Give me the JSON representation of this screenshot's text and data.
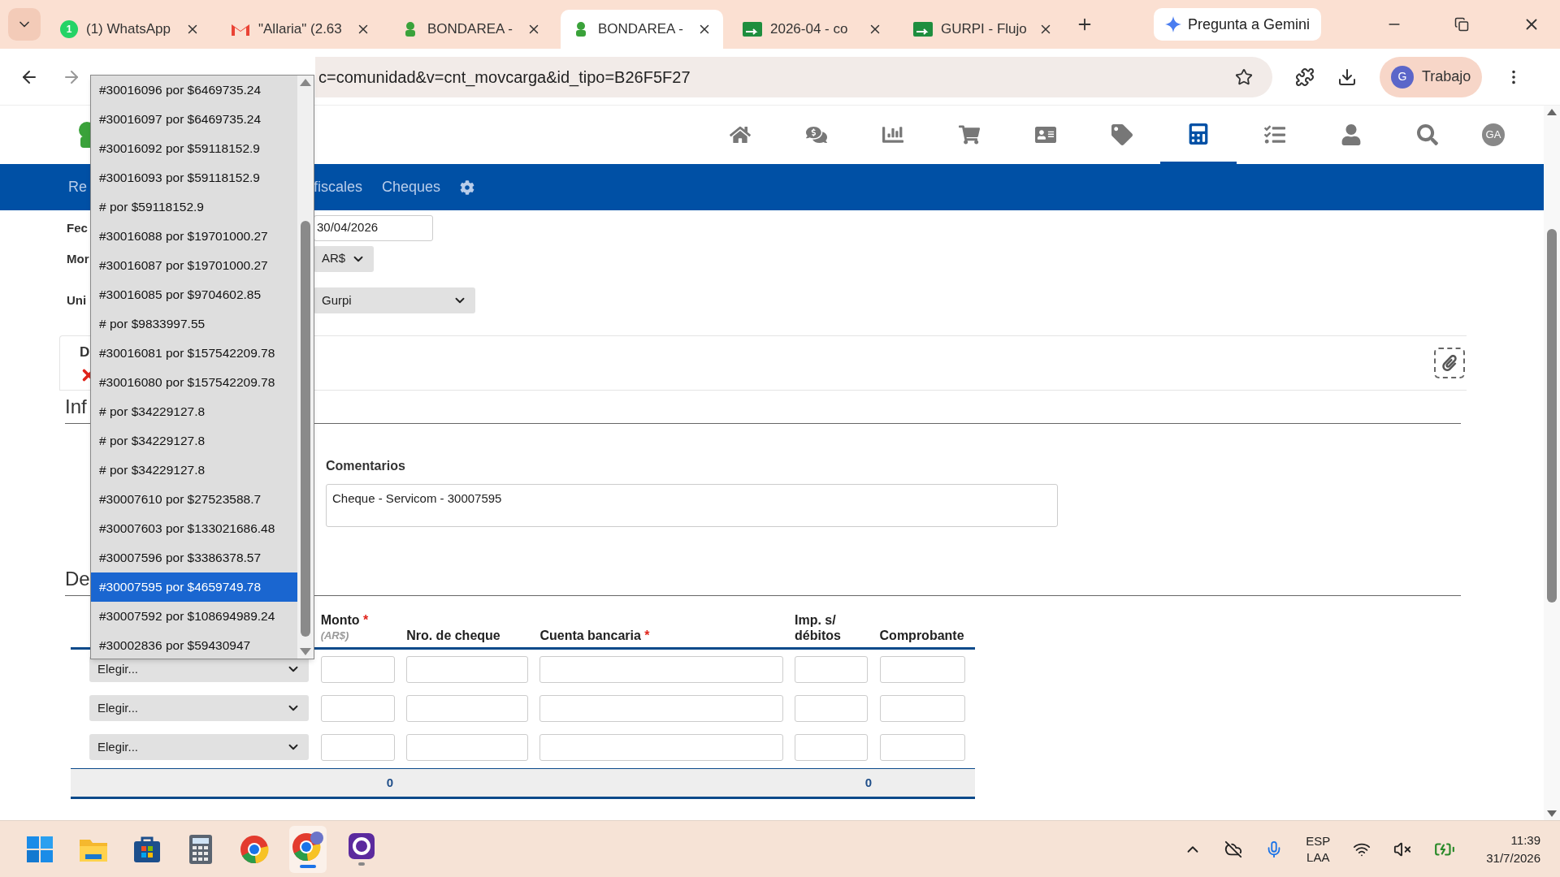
{
  "browser": {
    "tabs": [
      {
        "title": "(1) WhatsApp",
        "kind": "whatsapp",
        "badge": "1",
        "selected": false
      },
      {
        "title": "\"Allaria\" (2.63",
        "kind": "gmail",
        "selected": false
      },
      {
        "title": "BONDAREA -",
        "kind": "bondarea",
        "selected": false
      },
      {
        "title": "BONDAREA -",
        "kind": "bondarea",
        "selected": true
      },
      {
        "title": "2026-04 - co",
        "kind": "sheets",
        "selected": false
      },
      {
        "title": "GURPI - Flujo",
        "kind": "sheets",
        "selected": false
      }
    ],
    "gemini": "Pregunta a Gemini",
    "url": "c=comunidad&v=cnt_movcarga&id_tipo=B26F5F27",
    "profile": {
      "initial": "G",
      "label": "Trabajo"
    }
  },
  "header": {
    "icons": [
      {
        "kind": "home",
        "selected": false
      },
      {
        "kind": "chat",
        "selected": false
      },
      {
        "kind": "chart",
        "selected": false
      },
      {
        "kind": "cart",
        "selected": false
      },
      {
        "kind": "card",
        "selected": false
      },
      {
        "kind": "tag",
        "selected": false
      },
      {
        "kind": "calculator",
        "selected": true
      },
      {
        "kind": "tasks",
        "selected": false
      },
      {
        "kind": "user",
        "selected": false
      },
      {
        "kind": "search",
        "selected": false
      }
    ],
    "avatar": "GA"
  },
  "subnav": [
    "Re",
    "fiscales",
    "Cheques"
  ],
  "form": {
    "fields": [
      {
        "label": "Fec",
        "kind": "date",
        "value": "30/04/2026"
      },
      {
        "label": "Mor",
        "kind": "select",
        "value": "AR$"
      },
      {
        "label": "Uni",
        "kind": "select",
        "value": "Gurpi"
      }
    ]
  },
  "card": {
    "title": "D"
  },
  "sections": [
    "Inf",
    "De"
  ],
  "comments": {
    "label": "Comentarios",
    "value": "Cheque - Servicom - 30007595"
  },
  "table": {
    "columns": [
      {
        "title": "Monto",
        "required_mark": "*",
        "unit": "(AR$)"
      },
      {
        "title": "Nro. de cheque"
      },
      {
        "title": "Cuenta bancaria",
        "required_mark": "*"
      },
      {
        "title": "Imp. s/ débitos"
      },
      {
        "title": "Comprobante"
      }
    ],
    "rows": [
      {
        "selection": "Elegir..."
      },
      {
        "selection": "Elegir..."
      },
      {
        "selection": "Elegir..."
      }
    ],
    "totals": {
      "monto": "0",
      "imp": "0"
    }
  },
  "dropdown": {
    "options": [
      {
        "label": "#30016096 por $6469735.24",
        "selected": false
      },
      {
        "label": "#30016097 por $6469735.24",
        "selected": false
      },
      {
        "label": "#30016092 por $59118152.9",
        "selected": false
      },
      {
        "label": "#30016093 por $59118152.9",
        "selected": false
      },
      {
        "label": "# por $59118152.9",
        "selected": false
      },
      {
        "label": "#30016088 por $19701000.27",
        "selected": false
      },
      {
        "label": "#30016087 por $19701000.27",
        "selected": false
      },
      {
        "label": "#30016085 por $9704602.85",
        "selected": false
      },
      {
        "label": "# por $9833997.55",
        "selected": false
      },
      {
        "label": "#30016081 por $157542209.78",
        "selected": false
      },
      {
        "label": "#30016080 por $157542209.78",
        "selected": false
      },
      {
        "label": "# por $34229127.8",
        "selected": false
      },
      {
        "label": "# por $34229127.8",
        "selected": false
      },
      {
        "label": "# por $34229127.8",
        "selected": false
      },
      {
        "label": "#30007610 por $27523588.7",
        "selected": false
      },
      {
        "label": "#30007603 por $133021686.48",
        "selected": false
      },
      {
        "label": "#30007596 por $3386378.57",
        "selected": false
      },
      {
        "label": "#30007595 por $4659749.78",
        "selected": true
      },
      {
        "label": "#30007592 por $108694989.24",
        "selected": false
      },
      {
        "label": "#30002836 por $59430947",
        "selected": false
      }
    ]
  },
  "taskbar": {
    "apps": [
      {
        "kind": "windows",
        "active": false,
        "running": false
      },
      {
        "kind": "folder",
        "active": false,
        "running": false
      },
      {
        "kind": "store",
        "active": false,
        "running": false
      },
      {
        "kind": "calculator",
        "active": false,
        "running": false
      },
      {
        "kind": "chrome",
        "active": false,
        "running": false
      },
      {
        "kind": "chrome-profile",
        "active": true,
        "running": true
      },
      {
        "kind": "app",
        "active": false,
        "running": true
      }
    ],
    "language": [
      "ESP",
      "LAA"
    ],
    "time": "11:39",
    "date": "31/7/2026"
  }
}
